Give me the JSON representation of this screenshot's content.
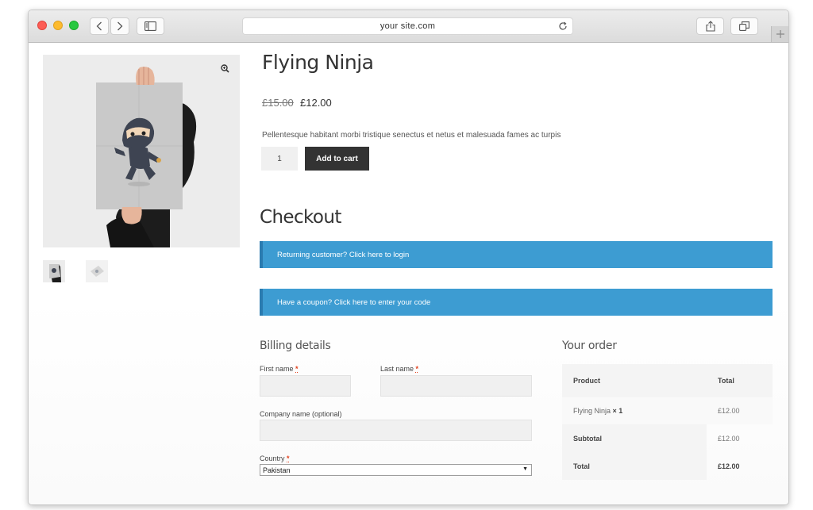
{
  "browser": {
    "url": "your site.com"
  },
  "product": {
    "title": "Flying Ninja",
    "price_old": "£15.00",
    "price_new": "£12.00",
    "description": "Pellentesque habitant morbi tristique senectus et netus et malesuada fames ac turpis",
    "quantity": "1",
    "add_to_cart_label": "Add to cart"
  },
  "checkout": {
    "title": "Checkout",
    "notice_login": "Returning customer? Click here to login",
    "notice_coupon": "Have a coupon? Click here to enter your code"
  },
  "billing": {
    "heading": "Billing details",
    "first_name_label": "First name",
    "last_name_label": "Last name",
    "company_label": "Company name (optional)",
    "country_label": "Country",
    "required_mark": "*",
    "country_value": "Pakistan"
  },
  "order": {
    "heading": "Your order",
    "col_product": "Product",
    "col_total": "Total",
    "item_name": "Flying Ninja",
    "item_qty": "× 1",
    "item_total": "£12.00",
    "subtotal_label": "Subtotal",
    "subtotal_value": "£12.00",
    "total_label": "Total",
    "total_value": "£12.00"
  },
  "colors": {
    "notice_blue": "#3d9cd2",
    "button_dark": "#333333",
    "required_red": "#e2401c"
  }
}
